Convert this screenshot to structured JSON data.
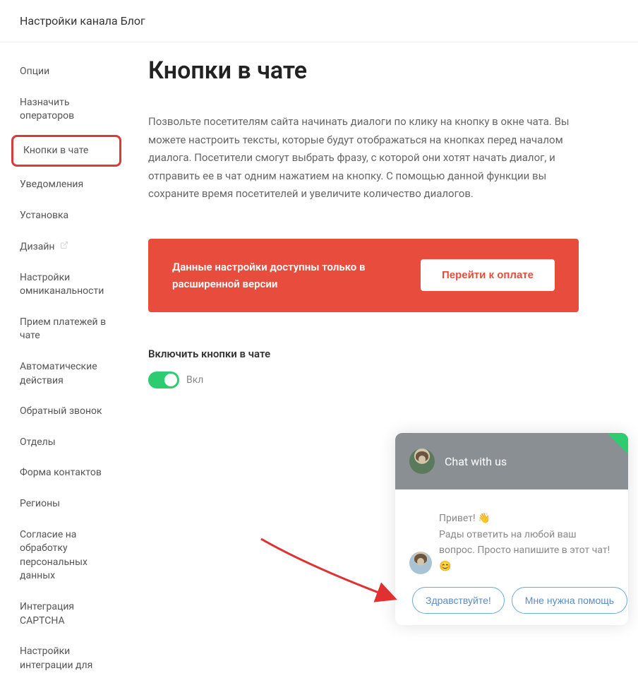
{
  "header": {
    "title": "Настройки канала Блог"
  },
  "sidebar": {
    "items": [
      {
        "label": "Опции"
      },
      {
        "label": "Назначить операторов"
      },
      {
        "label": "Кнопки в чате",
        "highlighted": true
      },
      {
        "label": "Уведомления"
      },
      {
        "label": "Установка"
      },
      {
        "label": "Дизайн",
        "external": true
      },
      {
        "label": "Настройки омниканальности"
      },
      {
        "label": "Прием платежей в чате"
      },
      {
        "label": "Автоматические действия"
      },
      {
        "label": "Обратный звонок"
      },
      {
        "label": "Отделы"
      },
      {
        "label": "Форма контактов"
      },
      {
        "label": "Регионы"
      },
      {
        "label": "Согласие на обработку персональных данных"
      },
      {
        "label": "Интеграция CAPTCHA"
      },
      {
        "label": "Настройки интеграции для"
      }
    ]
  },
  "main": {
    "title": "Кнопки в чате",
    "description": "Позвольте посетителям сайта начинать диалоги по клику на кнопку в окне чата. Вы можете настроить тексты, которые будут отображаться на кнопках перед началом диалога. Посетители смогут выбрать фразу, с которой они хотят начать диалог, и отправить ее в чат одним нажатием на кнопку. С помощью данной функции вы сохраните время посетителей и увеличите количество диалогов.",
    "alert": {
      "text": "Данные настройки доступны только в расширенной версии",
      "button": "Перейти к оплате"
    },
    "toggle": {
      "label": "Включить кнопки в чате",
      "status": "Вкл"
    }
  },
  "chat_widget": {
    "header_title": "Chat with us",
    "greeting": "Привет! 👋",
    "message": "Рады ответить на любой ваш вопрос. Просто напишите в этот чат! 😊",
    "buttons": [
      {
        "label": "Здравствуйте!"
      },
      {
        "label": "Мне нужна помощь"
      }
    ]
  }
}
